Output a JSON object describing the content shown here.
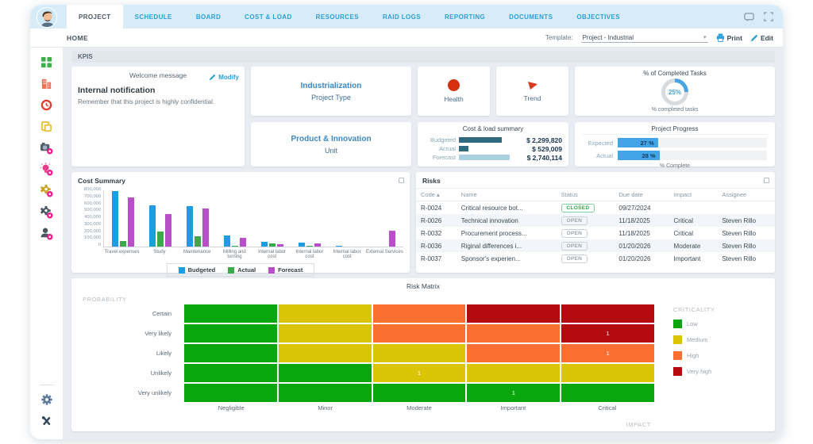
{
  "colors": {
    "accent": "#2b9fd8",
    "topbar_bg": "#d8ecf8",
    "content_bg": "#e9edf3",
    "health_dot": "#d63011",
    "donut_fill": "#4aa3e2",
    "progress_fill": "#42a5e8",
    "mini_bar_dark": "#2f6a80",
    "mini_bar_light": "#a9d1df",
    "closed_badge": "#27a844",
    "open_badge": "#9aa4ad"
  },
  "topbar": {
    "tabs": [
      {
        "label": "PROJECT",
        "active": true
      },
      {
        "label": "SCHEDULE",
        "active": false
      },
      {
        "label": "BOARD",
        "active": false
      },
      {
        "label": "COST & LOAD",
        "active": false
      },
      {
        "label": "RESOURCES",
        "active": false
      },
      {
        "label": "RAID LOGS",
        "active": false
      },
      {
        "label": "REPORTING",
        "active": false
      },
      {
        "label": "DOCUMENTS",
        "active": false
      },
      {
        "label": "OBJECTIVES",
        "active": false
      }
    ]
  },
  "subbar": {
    "breadcrumb": "HOME",
    "template_label": "Template:",
    "template_value": "Project - Industrial",
    "print_label": "Print",
    "edit_label": "Edit"
  },
  "sidebar": {
    "icons": [
      "dashboard-grid-icon",
      "building-icon",
      "clock-icon",
      "documents-icon",
      "portfolio-icon",
      "idea-icon",
      "process-gear-yellow-icon",
      "process-gear-dark-icon",
      "resources-user-icon"
    ],
    "bottom_icons": [
      "settings-gear-icon",
      "admin-tools-icon"
    ]
  },
  "kpis": {
    "section_label": "KPIS",
    "welcome": {
      "title": "Welcome message",
      "modify_label": "Modify",
      "heading": "Internal notification",
      "body": "Remember that this project is highly confidential."
    },
    "industrialization": {
      "title": "Industrialization",
      "subtitle": "Project Type"
    },
    "product": {
      "title": "Product & Innovation",
      "subtitle": "Unit"
    },
    "health": {
      "label": "Health"
    },
    "trend": {
      "label": "Trend"
    },
    "completed": {
      "title": "% of Completed Tasks",
      "value": "25%",
      "percent": 25,
      "caption": "% completed tasks"
    },
    "cost_load": {
      "title": "Cost & load summary",
      "max_value": 2740114,
      "rows": [
        {
          "label": "Budgeted",
          "value": "$ 2,299,820",
          "amount": 2299820,
          "shade": "dark"
        },
        {
          "label": "Actual",
          "value": "$ 529,009",
          "amount": 529009,
          "shade": "dark"
        },
        {
          "label": "Forecast",
          "value": "$ 2,740,114",
          "amount": 2740114,
          "shade": "light"
        }
      ]
    },
    "progress": {
      "title": "Project Progress",
      "rows": [
        {
          "label": "Expected",
          "value": "27 %",
          "percent": 27
        },
        {
          "label": "Actual",
          "value": "28 %",
          "percent": 28
        }
      ],
      "caption": "% Complete"
    }
  },
  "chart_data": [
    {
      "type": "bar",
      "title": "Cost Summary",
      "categories": [
        "Travel expenses",
        "Study",
        "Maintenance",
        "Milling and turning",
        "Internal labor cost",
        "Internal labor cost",
        "Internal labor cost",
        "External Services"
      ],
      "series": [
        {
          "name": "Budgeted",
          "color": "#1e9ce0",
          "values": [
            790000,
            590000,
            580000,
            160000,
            70000,
            55000,
            15000,
            0
          ]
        },
        {
          "name": "Actual",
          "color": "#3aaa4a",
          "values": [
            80000,
            215000,
            150000,
            10000,
            40000,
            8000,
            0,
            0
          ]
        },
        {
          "name": "Forecast",
          "color": "#b84fc9",
          "values": [
            700000,
            460000,
            540000,
            120000,
            35000,
            50000,
            0,
            230000
          ]
        }
      ],
      "ylim": [
        0,
        800000
      ],
      "y_ticks": [
        "800,000",
        "700,000",
        "600,000",
        "500,000",
        "400,000",
        "300,000",
        "200,000",
        "100,000",
        "0"
      ],
      "legend_position": "bottom"
    },
    {
      "type": "heatmap",
      "title": "Risk Matrix",
      "x_axis_label": "IMPACT",
      "y_axis_label": "PROBABILITY",
      "rows": [
        "Certain",
        "Very likely",
        "Likely",
        "Unlikely",
        "Very unlikely"
      ],
      "cols": [
        "Negligible",
        "Minor",
        "Moderate",
        "Important",
        "Critical"
      ],
      "cells": [
        [
          "low",
          "medium",
          "high",
          "veryhigh",
          "veryhigh"
        ],
        [
          "low",
          "medium",
          "high",
          "high",
          "veryhigh:1"
        ],
        [
          "low",
          "medium",
          "medium",
          "high",
          "high:1"
        ],
        [
          "low",
          "low",
          "medium:1",
          "medium",
          "medium"
        ],
        [
          "low",
          "low",
          "low",
          "low:1",
          "low"
        ]
      ],
      "level_colors": {
        "low": "#0aa60d",
        "medium": "#d9c406",
        "high": "#fb7030",
        "veryhigh": "#b30b0f"
      },
      "legend": {
        "title": "CRITICALITY",
        "items": [
          {
            "label": "Low",
            "level": "low"
          },
          {
            "label": "Medium",
            "level": "medium"
          },
          {
            "label": "High",
            "level": "high"
          },
          {
            "label": "Very high",
            "level": "veryhigh"
          }
        ]
      }
    }
  ],
  "risks": {
    "title": "Risks",
    "columns": [
      "Code",
      "Name",
      "Status",
      "Due date",
      "Impact",
      "Assignee"
    ],
    "sort_column": "Code",
    "rows": [
      {
        "code": "R-0024",
        "name": "Critical resource bot...",
        "status": "CLOSED",
        "due": "09/27/2024",
        "impact": "",
        "assignee": ""
      },
      {
        "code": "R-0026",
        "name": "Technical innovation",
        "status": "OPEN",
        "due": "11/18/2025",
        "impact": "Critical",
        "assignee": "Steven Rillo"
      },
      {
        "code": "R-0032",
        "name": "Procurement process...",
        "status": "OPEN",
        "due": "11/18/2025",
        "impact": "Critical",
        "assignee": "Steven Rillo"
      },
      {
        "code": "R-0036",
        "name": "Riginal differences i...",
        "status": "OPEN",
        "due": "01/20/2026",
        "impact": "Moderate",
        "assignee": "Steven Rillo"
      },
      {
        "code": "R-0037",
        "name": "Sponsor's experien...",
        "status": "OPEN",
        "due": "01/20/2026",
        "impact": "Important",
        "assignee": "Steven Rillo"
      }
    ]
  }
}
